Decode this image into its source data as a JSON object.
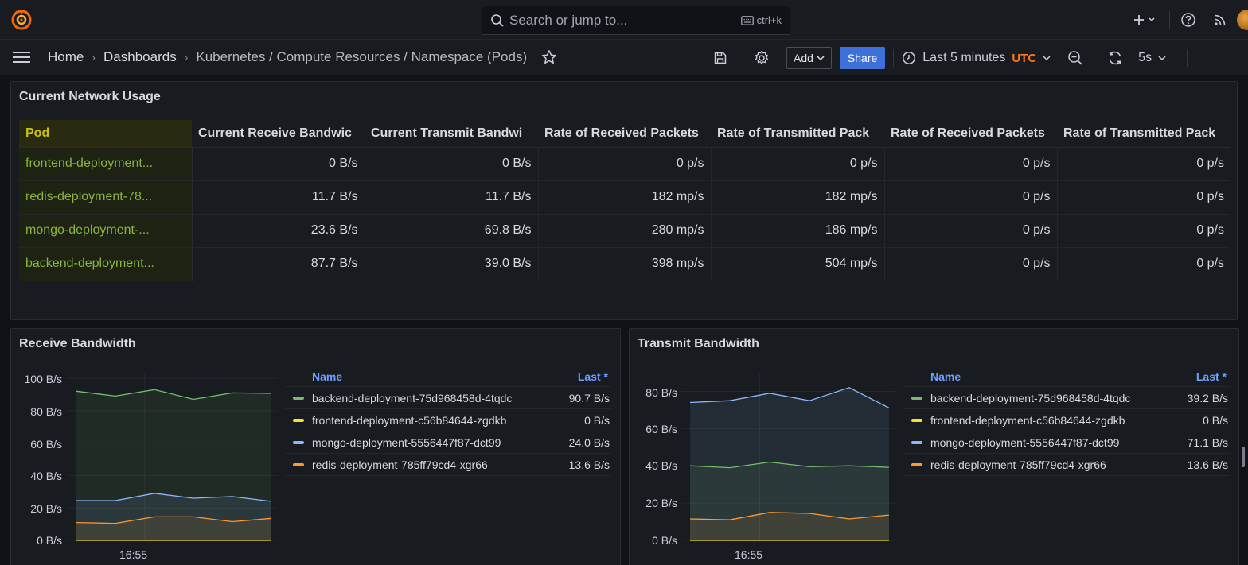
{
  "topbar": {
    "search_placeholder": "Search or jump to...",
    "search_shortcut": "ctrl+k"
  },
  "breadcrumb": {
    "home": "Home",
    "dashboards": "Dashboards",
    "current": "Kubernetes / Compute Resources / Namespace (Pods)"
  },
  "toolbar": {
    "add_label": "Add",
    "share_label": "Share",
    "time_range": "Last 5 minutes",
    "timezone": "UTC",
    "refresh_interval": "5s"
  },
  "network_table": {
    "title": "Current Network Usage",
    "headers": [
      "Pod",
      "Current Receive Bandwic",
      "Current Transmit Bandwi",
      "Rate of Received Packets",
      "Rate of Transmitted Pack",
      "Rate of Received Packets",
      "Rate of Transmitted Pack"
    ],
    "rows": [
      [
        "frontend-deployment...",
        "0 B/s",
        "0 B/s",
        "0 p/s",
        "0 p/s",
        "0 p/s",
        "0 p/s"
      ],
      [
        "redis-deployment-78...",
        "11.7 B/s",
        "11.7 B/s",
        "182 mp/s",
        "182 mp/s",
        "0 p/s",
        "0 p/s"
      ],
      [
        "mongo-deployment-...",
        "23.6 B/s",
        "69.8 B/s",
        "280 mp/s",
        "186 mp/s",
        "0 p/s",
        "0 p/s"
      ],
      [
        "backend-deployment...",
        "87.7 B/s",
        "39.0 B/s",
        "398 mp/s",
        "504 mp/s",
        "0 p/s",
        "0 p/s"
      ]
    ]
  },
  "receive_panel": {
    "title": "Receive Bandwidth",
    "legend_name_header": "Name",
    "legend_last_header": "Last *",
    "legend": [
      {
        "name": "backend-deployment-75d968458d-4tqdc",
        "last": "90.7 B/s",
        "color": "#73bf69"
      },
      {
        "name": "frontend-deployment-c56b84644-zgdkb",
        "last": "0 B/s",
        "color": "#fade2a"
      },
      {
        "name": "mongo-deployment-5556447f87-dct99",
        "last": "24.0 B/s",
        "color": "#8ab8ff"
      },
      {
        "name": "redis-deployment-785ff79cd4-xgr66",
        "last": "13.6 B/s",
        "color": "#ff9830"
      }
    ],
    "y_ticks": [
      "100 B/s",
      "80 B/s",
      "60 B/s",
      "40 B/s",
      "20 B/s",
      "0 B/s"
    ],
    "x_tick": "16:55"
  },
  "transmit_panel": {
    "title": "Transmit Bandwidth",
    "legend_name_header": "Name",
    "legend_last_header": "Last *",
    "legend": [
      {
        "name": "backend-deployment-75d968458d-4tqdc",
        "last": "39.2 B/s",
        "color": "#73bf69"
      },
      {
        "name": "frontend-deployment-c56b84644-zgdkb",
        "last": "0 B/s",
        "color": "#fade2a"
      },
      {
        "name": "mongo-deployment-5556447f87-dct99",
        "last": "71.1 B/s",
        "color": "#8ab8ff"
      },
      {
        "name": "redis-deployment-785ff79cd4-xgr66",
        "last": "13.6 B/s",
        "color": "#ff9830"
      }
    ],
    "y_ticks": [
      "80 B/s",
      "60 B/s",
      "40 B/s",
      "20 B/s",
      "0 B/s"
    ],
    "x_tick": "16:55"
  },
  "chart_data": [
    {
      "type": "area",
      "title": "Receive Bandwidth",
      "ylim": [
        0,
        100
      ],
      "ylabel": "",
      "series": [
        {
          "name": "backend-deployment-75d968458d-4tqdc",
          "values": [
            92,
            89,
            93,
            87,
            91,
            90.7
          ]
        },
        {
          "name": "mongo-deployment-5556447f87-dct99",
          "values": [
            24.5,
            24.5,
            29,
            26,
            27,
            24
          ]
        },
        {
          "name": "redis-deployment-785ff79cd4-xgr66",
          "values": [
            11,
            10.5,
            14.5,
            14.5,
            11.5,
            13.6
          ]
        },
        {
          "name": "frontend-deployment-c56b84644-zgdkb",
          "values": [
            0,
            0,
            0,
            0,
            0,
            0
          ]
        }
      ]
    },
    {
      "type": "area",
      "title": "Transmit Bandwidth",
      "ylim": [
        0,
        90
      ],
      "ylabel": "",
      "series": [
        {
          "name": "mongo-deployment-5556447f87-dct99",
          "values": [
            74,
            75,
            79,
            75,
            82,
            71.1
          ]
        },
        {
          "name": "backend-deployment-75d968458d-4tqdc",
          "values": [
            40,
            39,
            42,
            39.5,
            40,
            39.2
          ]
        },
        {
          "name": "redis-deployment-785ff79cd4-xgr66",
          "values": [
            11.5,
            11,
            15,
            14.5,
            11.5,
            13.6
          ]
        },
        {
          "name": "frontend-deployment-c56b84644-zgdkb",
          "values": [
            0,
            0,
            0,
            0,
            0,
            0
          ]
        }
      ]
    }
  ]
}
